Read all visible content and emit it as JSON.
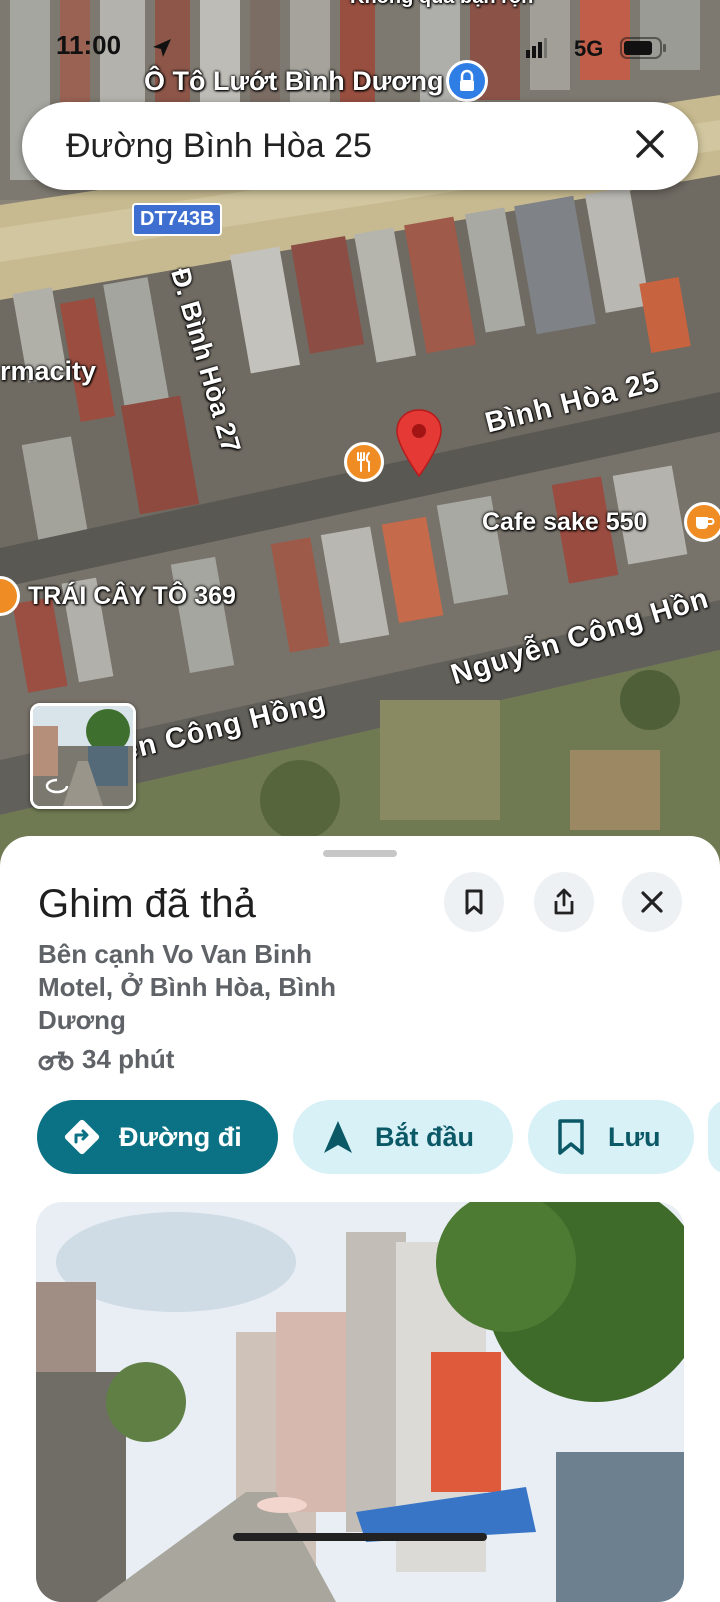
{
  "status_bar": {
    "time": "11:00",
    "network": "5G"
  },
  "search": {
    "query": "Đường Bình Hòa 25"
  },
  "map": {
    "top_label_partial": "Không quá bận rộn",
    "business_label": "Ô Tô Lướt Bình Dương",
    "highway_shield": "DT743B",
    "street_binh_hoa_27": "Đ. Bình Hòa 27",
    "street_binh_hoa_25": "Bình Hòa 25",
    "pharmacity_partial": "rmacity",
    "cafe_label": "Cafe sake 550",
    "fruit_label": "TRÁI CÂY TÔ 369",
    "street_nguyen_cong_hong_right": "Nguyễn Công Hồn",
    "street_nguyen_cong_hong_left": "ễn Công Hồng",
    "icons": [
      "location-arrow-icon",
      "signal-icon",
      "battery-icon",
      "lock-icon",
      "close-icon",
      "restaurant-icon",
      "coffee-icon",
      "map-pin-icon",
      "street-view-rotate-icon"
    ]
  },
  "sheet": {
    "title": "Ghim đã thả",
    "address": "Bên cạnh Vo Van Binh Motel, Ở Bình Hòa, Bình Dương",
    "eta": "34 phút",
    "directions_label": "Đường đi",
    "start_label": "Bắt đầu",
    "save_label": "Lưu",
    "colors": {
      "primary": "#0b7285",
      "secondary": "#d7f1f7",
      "pin": "#e53935",
      "poi": "#f08c24"
    }
  }
}
